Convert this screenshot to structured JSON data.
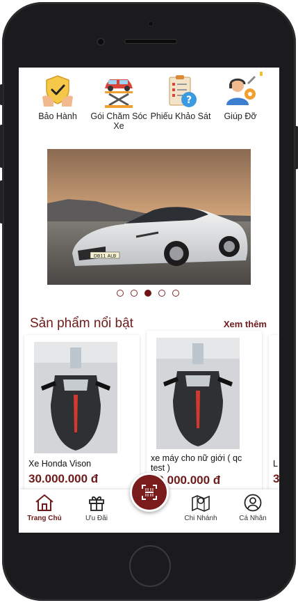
{
  "services": [
    {
      "label": "Bảo Hành",
      "icon": "warranty-shield-icon"
    },
    {
      "label": "Gói Chăm Sóc Xe",
      "icon": "car-lift-icon"
    },
    {
      "label": "Phiếu Khảo Sát",
      "icon": "survey-clipboard-icon"
    },
    {
      "label": "Giúp Đỡ",
      "icon": "support-agent-icon"
    }
  ],
  "banner": {
    "plate_text": "DB11 ALB",
    "slide_count": 5,
    "active_slide": 3
  },
  "featured": {
    "title": "Sản phẩm nổi bật",
    "see_more": "Xem thêm",
    "products": [
      {
        "name": "Xe Honda Vison",
        "price": "30.000.000 đ"
      },
      {
        "name": "xe máy cho nữ giới ( qc test )",
        "price": "30.000.000 đ"
      },
      {
        "name": "L",
        "price": "3"
      }
    ]
  },
  "tabbar": {
    "items": [
      {
        "label": "Trang Chủ",
        "icon": "home-icon",
        "active": true
      },
      {
        "label": "Ưu Đãi",
        "icon": "gift-icon",
        "active": false
      },
      {
        "label": "Chi Nhánh",
        "icon": "map-pin-icon",
        "active": false
      },
      {
        "label": "Cá Nhân",
        "icon": "user-icon",
        "active": false
      }
    ],
    "scan_icon": "qr-scan-icon"
  },
  "colors": {
    "accent": "#6e1a1a",
    "scan_button": "#7a1c1c"
  }
}
